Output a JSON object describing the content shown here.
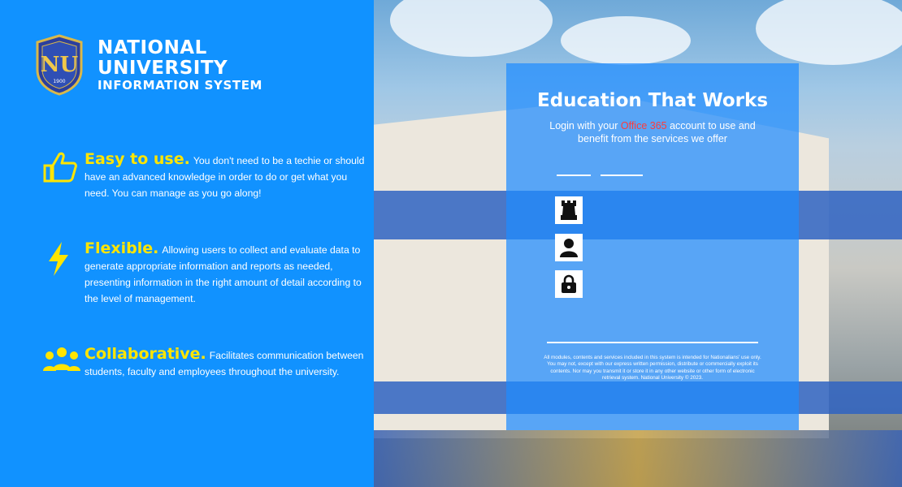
{
  "brand": {
    "line1": "NATIONAL",
    "line2": "UNIVERSITY",
    "line3": "INFORMATION SYSTEM",
    "seal_year": "1900"
  },
  "features": [
    {
      "title": "Easy to use.",
      "text": "You don't need to be a techie or should have an advanced knowledge in order to do or get what you need. You can manage as you go along!",
      "icon": "thumbs-up-icon"
    },
    {
      "title": "Flexible.",
      "text": "Allowing users to collect and evaluate data to generate appropriate information and reports as needed, presenting information in the right amount of detail according to the level of management.",
      "icon": "lightning-icon"
    },
    {
      "title": "Collaborative.",
      "text": "Facilitates communication between students, faculty and employees throughout the university.",
      "icon": "users-icon"
    }
  ],
  "login": {
    "title": "Education That Works",
    "sub_before": "Login with your ",
    "sub_highlight": "Office 365",
    "sub_after": " account to use and benefit from the services we offer",
    "disclaimer": "All modules, contents and services included in this system is intended for Nationalians' use only. You may not, except with our express written permission, distribute or commercially exploit its contents. Nor may you transmit it or store it in any other website or other form of electronic retrieval system. National University © 2023."
  },
  "colors": {
    "panel_blue": "#1192FF",
    "heading_yellow": "#FFE500",
    "highlight_red": "#FF3B3B"
  }
}
